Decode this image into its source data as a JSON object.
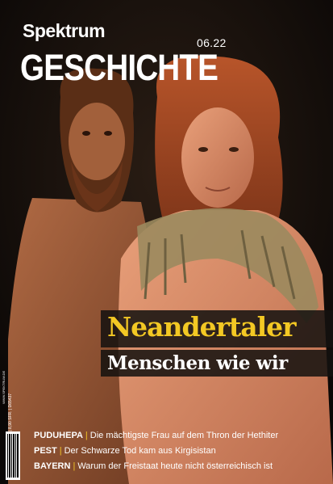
{
  "masthead": {
    "brand": "Spektrum",
    "title": "GESCHICHTE",
    "issue": "06.22"
  },
  "cover_story": {
    "headline": "Neandertaler",
    "subline": "Menschen wie wir"
  },
  "teasers": [
    {
      "keyword": "PUDUHEPA",
      "text": "Die mächtigste Frau auf dem Thron der Hethiter"
    },
    {
      "keyword": "PEST",
      "text": "Der Schwarze Tod kam aus Kirgisistan"
    },
    {
      "keyword": "BAYERN",
      "text": "Warum der Freistaat heute nicht österreichisch ist"
    }
  ],
  "spine_info": {
    "price_line": "5,90 € (D/A) | 8,90 SFR. | D65437",
    "website": "WWW.SPEKTRUM.DE"
  },
  "colors": {
    "accent_yellow": "#f3c824",
    "background": "#0c0907"
  },
  "photo": {
    "subject": "neanderthal-man-and-woman-reconstructions"
  }
}
